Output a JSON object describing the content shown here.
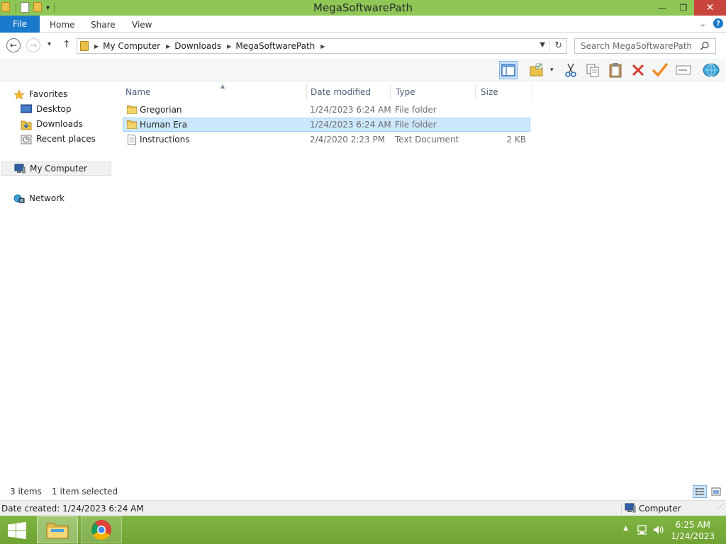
{
  "window": {
    "title": "MegaSoftwarePath"
  },
  "ribbon": {
    "file_tab": "File",
    "tabs": [
      "Home",
      "Share",
      "View"
    ]
  },
  "address": {
    "crumbs": [
      "My Computer",
      "Downloads",
      "MegaSoftwarePath"
    ]
  },
  "search": {
    "placeholder": "Search MegaSoftwarePath"
  },
  "nav_pane": {
    "favorites_label": "Favorites",
    "favorites": [
      "Desktop",
      "Downloads",
      "Recent places"
    ],
    "computer_label": "My Computer",
    "network_label": "Network"
  },
  "columns": {
    "name": "Name",
    "date": "Date modified",
    "type": "Type",
    "size": "Size"
  },
  "files": [
    {
      "name": "Gregorian",
      "date": "1/24/2023 6:24 AM",
      "type": "File folder",
      "size": "",
      "icon": "folder-icon",
      "selected": false
    },
    {
      "name": "Human Era",
      "date": "1/24/2023 6:24 AM",
      "type": "File folder",
      "size": "",
      "icon": "folder-icon",
      "selected": true
    },
    {
      "name": "Instructions",
      "date": "2/4/2020 2:23 PM",
      "type": "Text Document",
      "size": "2 KB",
      "icon": "text-document-icon",
      "selected": false
    }
  ],
  "status": {
    "items_count": "3 items",
    "selected_count": "1 item selected"
  },
  "details": {
    "date_created": "Date created: 1/24/2023 6:24 AM",
    "location": "Computer"
  },
  "clock": {
    "time": "6:25 AM",
    "date": "1/24/2023"
  },
  "colors": {
    "titlebar": "#8fc757",
    "file_tab": "#1979ca",
    "selection": "#cce8ff",
    "taskbar": "#77aa3a",
    "close_button": "#c8443c"
  }
}
